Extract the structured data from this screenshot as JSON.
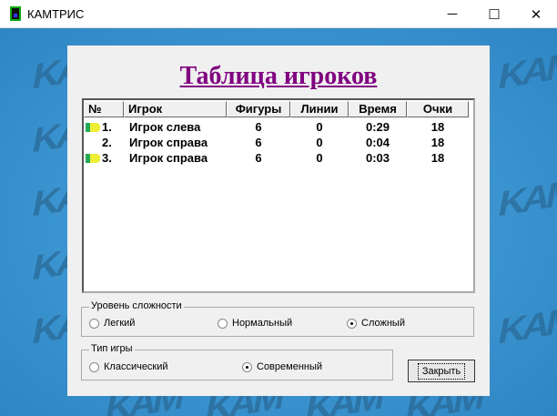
{
  "window": {
    "title": "КАМТРИС",
    "minimize": "─",
    "maximize": "☐",
    "close": "✕"
  },
  "watermark": "KAM",
  "dialog": {
    "title": "Таблица игроков",
    "columns": [
      "№",
      "Игрок",
      "Фигуры",
      "Линии",
      "Время",
      "Очки"
    ],
    "rows": [
      {
        "num": "1.",
        "player": "Игрок слева",
        "figures": "6",
        "lines": "0",
        "time": "0:29",
        "score": "18",
        "pointer": true
      },
      {
        "num": "2.",
        "player": "Игрок справа",
        "figures": "6",
        "lines": "0",
        "time": "0:04",
        "score": "18",
        "pointer": false
      },
      {
        "num": "3.",
        "player": "Игрок справа",
        "figures": "6",
        "lines": "0",
        "time": "0:03",
        "score": "18",
        "pointer": true
      }
    ],
    "difficulty": {
      "label": "Уровень сложности",
      "options": [
        "Легкий",
        "Нормальный",
        "Сложный"
      ],
      "selected": "Сложный"
    },
    "game_type": {
      "label": "Тип игры",
      "options": [
        "Классический",
        "Современный"
      ],
      "selected": "Современный"
    },
    "close_button": "Закрыть"
  }
}
